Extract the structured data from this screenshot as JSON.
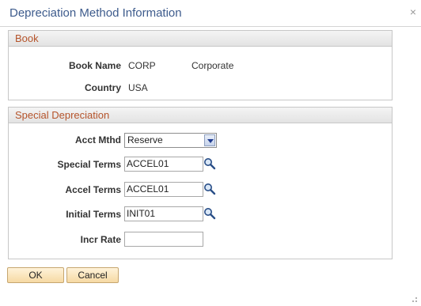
{
  "window": {
    "title": "Depreciation Method Information",
    "close_glyph": "×"
  },
  "book": {
    "header": "Book",
    "book_name_label": "Book Name",
    "book_name_value": "CORP",
    "book_description": "Corporate",
    "country_label": "Country",
    "country_value": "USA"
  },
  "special": {
    "header": "Special Depreciation",
    "acct_mthd_label": "Acct Mthd",
    "acct_mthd_value": "Reserve",
    "special_terms_label": "Special Terms",
    "special_terms_value": "ACCEL01",
    "accel_terms_label": "Accel Terms",
    "accel_terms_value": "ACCEL01",
    "initial_terms_label": "Initial Terms",
    "initial_terms_value": "INIT01",
    "incr_rate_label": "Incr Rate",
    "incr_rate_value": ""
  },
  "buttons": {
    "ok": "OK",
    "cancel": "Cancel"
  },
  "colors": {
    "title": "#3d5b8c",
    "group_header": "#b5542b",
    "button_bg": "#f6d9a3"
  }
}
